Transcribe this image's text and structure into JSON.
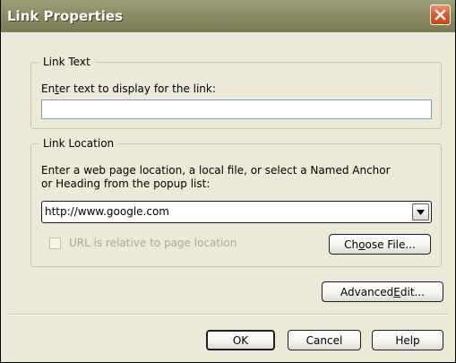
{
  "window": {
    "title": "Link Properties"
  },
  "link_text": {
    "legend": "Link Text",
    "prompt_pre": "En",
    "prompt_accel": "t",
    "prompt_post": "er text to display for the link:",
    "value": ""
  },
  "link_location": {
    "legend": "Link Location",
    "description_line1": "Enter a web page location, a local file, or select a Named Anchor",
    "description_line2": "or Heading from the popup list:",
    "url_value": "http://www.google.com",
    "relative_checkbox_label": "URL is relative to page location",
    "relative_checked": false,
    "choose_file_pre": "Ch",
    "choose_file_accel": "o",
    "choose_file_post": "ose File..."
  },
  "actions": {
    "advanced_edit_pre": "Advanced ",
    "advanced_edit_accel": "E",
    "advanced_edit_post": "dit...",
    "ok_label": "OK",
    "cancel_label": "Cancel",
    "help_label": "Help"
  }
}
